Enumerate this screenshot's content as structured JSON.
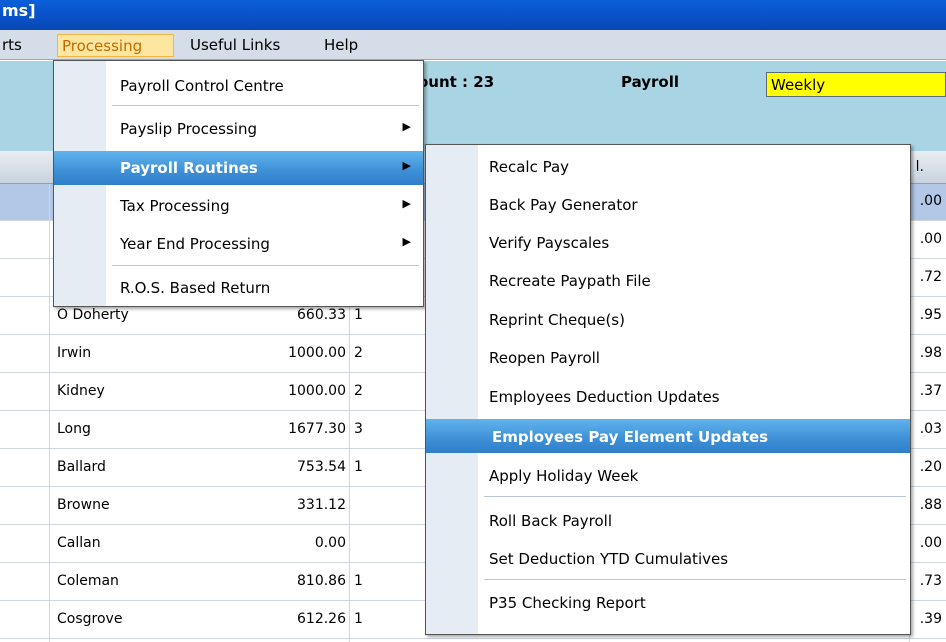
{
  "window": {
    "title": "ms]"
  },
  "menubar": {
    "items": [
      {
        "label": "rts",
        "id": "reports"
      },
      {
        "label": "Processing",
        "id": "processing",
        "active": true
      },
      {
        "label": "Useful Links",
        "id": "useful-links"
      },
      {
        "label": "Help",
        "id": "help"
      }
    ]
  },
  "header": {
    "count_label": "ount : 23",
    "payroll_label": "Payroll",
    "payroll_value": "Weekly"
  },
  "grid": {
    "header_fragment": "l.",
    "rows": [
      {
        "name": "",
        "amount": "",
        "code": "",
        "right": ".00",
        "selected": true
      },
      {
        "name": "",
        "amount": "",
        "code": "",
        "right": ".00"
      },
      {
        "name": "",
        "amount": "",
        "code": "",
        "right": ".72"
      },
      {
        "name": "O Doherty",
        "amount": "660.33",
        "code": "1",
        "right": ".95"
      },
      {
        "name": "Irwin",
        "amount": "1000.00",
        "code": "2",
        "right": ".98"
      },
      {
        "name": "Kidney",
        "amount": "1000.00",
        "code": "2",
        "right": ".37"
      },
      {
        "name": "Long",
        "amount": "1677.30",
        "code": "3",
        "right": ".03"
      },
      {
        "name": "Ballard",
        "amount": "753.54",
        "code": "1",
        "right": ".20"
      },
      {
        "name": "Browne",
        "amount": "331.12",
        "code": "",
        "right": ".88"
      },
      {
        "name": "Callan",
        "amount": "0.00",
        "code": "",
        "right": ".00"
      },
      {
        "name": "Coleman",
        "amount": "810.86",
        "code": "1",
        "right": ".73"
      },
      {
        "name": "Cosgrove",
        "amount": "612.26",
        "code": "1",
        "right": ".39"
      }
    ]
  },
  "processing_menu": {
    "items": [
      {
        "label": "Payroll Control Centre",
        "submenu": false
      },
      {
        "label": "Payslip Processing",
        "submenu": true
      },
      {
        "label": "Payroll Routines",
        "submenu": true,
        "highlighted": true
      },
      {
        "label": "Tax Processing",
        "submenu": true
      },
      {
        "label": "Year End Processing",
        "submenu": true
      },
      {
        "label": "R.O.S. Based Return",
        "submenu": false
      }
    ]
  },
  "routines_menu": {
    "items": [
      {
        "label": "Recalc Pay"
      },
      {
        "label": "Back Pay Generator"
      },
      {
        "label": "Verify Payscales"
      },
      {
        "label": "Recreate Paypath File"
      },
      {
        "label": "Reprint Cheque(s)"
      },
      {
        "label": "Reopen Payroll"
      },
      {
        "label": "Employees Deduction Updates"
      },
      {
        "label": "Employees Pay Element Updates",
        "highlighted": true
      },
      {
        "label": "Apply Holiday Week"
      },
      {
        "label": "Roll Back Payroll"
      },
      {
        "label": "Set Deduction YTD Cumulatives"
      },
      {
        "label": "P35 Checking Report"
      }
    ]
  },
  "icons": {
    "submenu_arrow": "triangle-right-icon"
  },
  "colors": {
    "titlebar": "#0a53cc",
    "header_bg": "#a8d4e4",
    "selected_row": "#b3c7e6",
    "highlight": "#3d8fd6",
    "payroll_select_bg": "#ffff00"
  }
}
